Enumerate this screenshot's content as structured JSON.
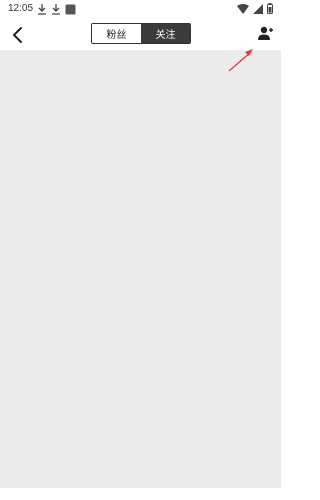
{
  "status_bar": {
    "time": "12:05",
    "left_icons": [
      "download-icon",
      "download-icon",
      "app-square-icon"
    ],
    "right_icons": [
      "wifi-icon",
      "signal-icon",
      "battery-icon"
    ]
  },
  "header": {
    "back_icon": "chevron-left-icon",
    "tabs": [
      {
        "label": "粉丝",
        "active": false
      },
      {
        "label": "关注",
        "active": true
      }
    ],
    "add_user_icon": "add-user-icon"
  },
  "content": {
    "background": "#ebebeb"
  },
  "annotation": {
    "color": "#e53935",
    "type": "arrow"
  }
}
